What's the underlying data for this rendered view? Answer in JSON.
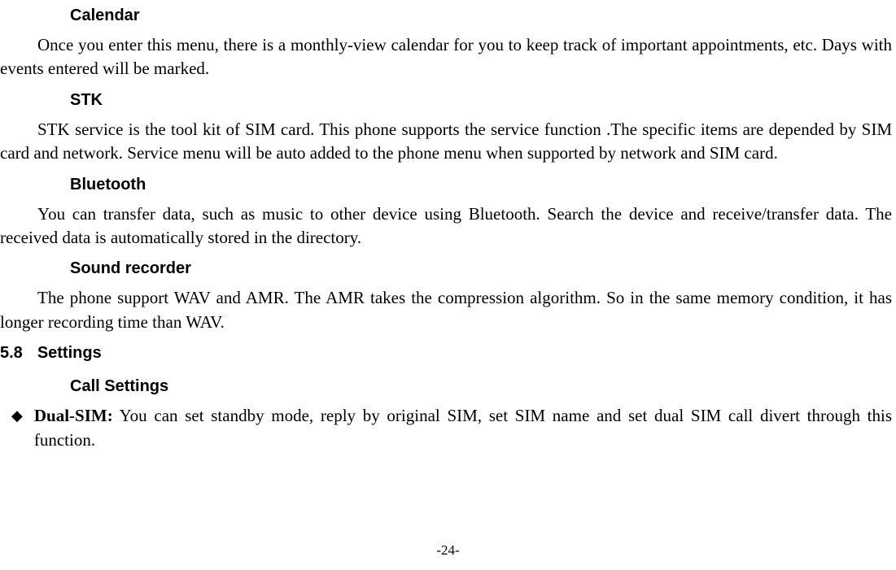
{
  "sections": {
    "calendar": {
      "title": "Calendar",
      "body": "Once you enter this menu, there is a monthly-view calendar for you to keep track of important appointments, etc. Days with events entered will be marked."
    },
    "stk": {
      "title": "STK",
      "body": "STK service is the tool kit of SIM card. This phone supports the service function .The specific items are depended by SIM card and network. Service menu will be auto added to the phone menu when supported by network and SIM card."
    },
    "bluetooth": {
      "title": "Bluetooth",
      "body": "You can transfer data, such as music to other device using Bluetooth. Search the device and receive/transfer data. The received data is automatically stored in the directory."
    },
    "soundRecorder": {
      "title": "Sound recorder",
      "body": "The phone support WAV and AMR. The AMR takes the compression algorithm. So in the same memory condition, it has longer recording time than WAV."
    },
    "settings": {
      "number": "5.8",
      "title": "Settings",
      "callSettings": {
        "title": "Call Settings",
        "dualSim": {
          "label": "Dual-SIM:",
          "text": " You can set standby mode, reply by original SIM, set SIM name and set dual SIM call divert through this function."
        }
      }
    }
  },
  "pageNumber": "-24-"
}
